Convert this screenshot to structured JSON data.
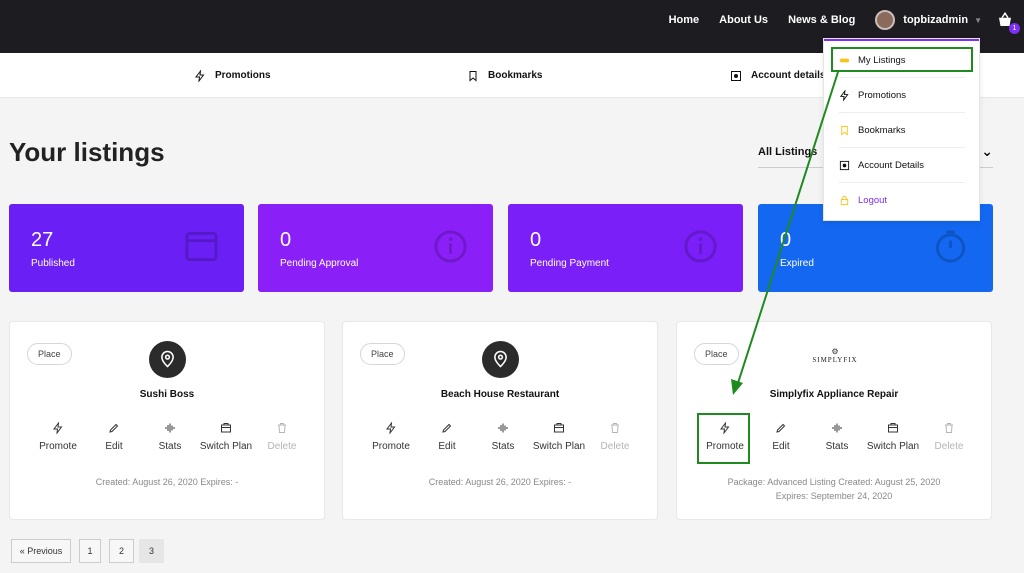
{
  "topnav": {
    "links": [
      "Home",
      "About Us",
      "News & Blog"
    ],
    "username": "topbizadmin",
    "cart_count": "1"
  },
  "subnav": {
    "items": [
      "Promotions",
      "Bookmarks",
      "Account details"
    ]
  },
  "page": {
    "title": "Your listings",
    "filter_value": "All Listings"
  },
  "stats": [
    {
      "value": "27",
      "label": "Published",
      "color": "#6a1ff5",
      "icon": "calendar-icon"
    },
    {
      "value": "0",
      "label": "Pending Approval",
      "color": "#8a1ff7",
      "icon": "info-icon"
    },
    {
      "value": "0",
      "label": "Pending Payment",
      "color": "#7a1ff7",
      "icon": "info-icon"
    },
    {
      "value": "0",
      "label": "Expired",
      "color": "#1367f0",
      "icon": "stopwatch-icon"
    }
  ],
  "listings": [
    {
      "tag": "Place",
      "title": "Sushi Boss",
      "logo": "map-pin-icon",
      "meta_line1": "Created:  August 26, 2020   Expires:  -",
      "meta_line2": ""
    },
    {
      "tag": "Place",
      "title": "Beach House Restaurant",
      "logo": "map-pin-icon",
      "meta_line1": "Created:  August 26, 2020   Expires:  -",
      "meta_line2": ""
    },
    {
      "tag": "Place",
      "title": "Simplyfix Appliance Repair",
      "logo_text": "SIMPLYFIX",
      "meta_line1": "Package:  Advanced Listing   Created:  August 25, 2020",
      "meta_line2": "Expires:  September 24, 2020"
    }
  ],
  "actions": [
    "Promote",
    "Edit",
    "Stats",
    "Switch Plan",
    "Delete"
  ],
  "pagination": {
    "previous": "« Previous",
    "pages": [
      "1",
      "2",
      "3"
    ],
    "current": "3"
  },
  "dropdown": {
    "items": [
      "My Listings",
      "Promotions",
      "Bookmarks",
      "Account Details",
      "Logout"
    ]
  },
  "colors": {
    "accent": "#7b2ff7",
    "annotation": "#1f8a1f",
    "topbar": "#1d1d21"
  }
}
